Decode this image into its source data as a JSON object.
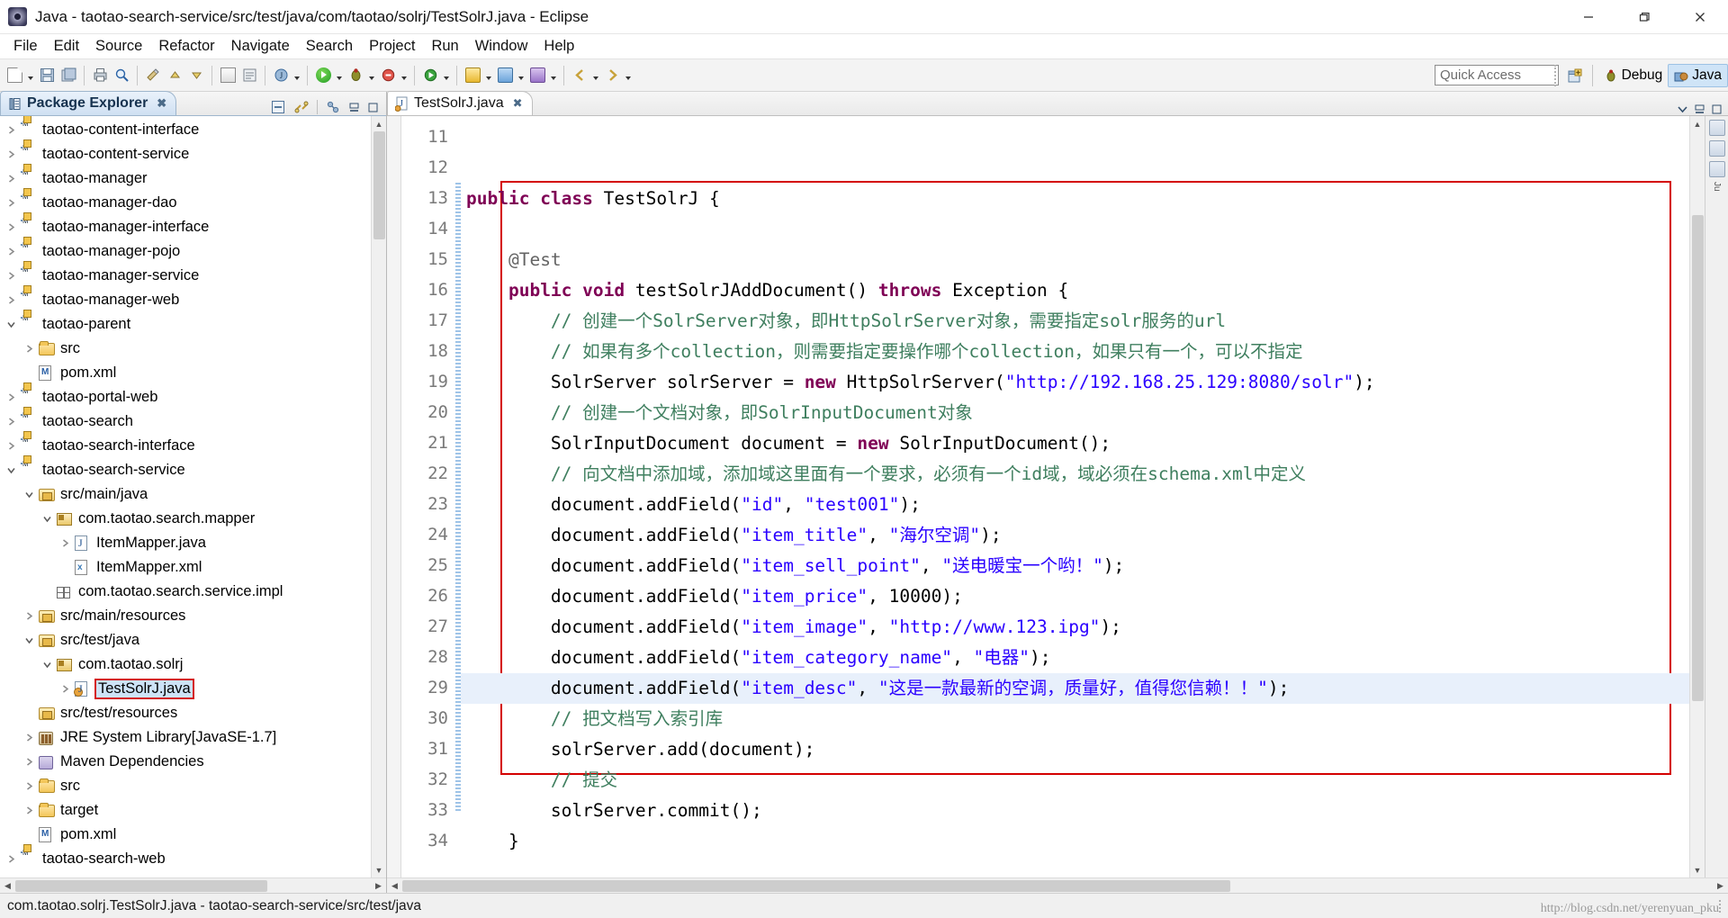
{
  "window": {
    "title": "Java - taotao-search-service/src/test/java/com/taotao/solrj/TestSolrJ.java - Eclipse",
    "minimize_label": "Minimize",
    "restore_label": "Restore",
    "close_label": "Close"
  },
  "menubar": {
    "items": [
      "File",
      "Edit",
      "Source",
      "Refactor",
      "Navigate",
      "Search",
      "Project",
      "Run",
      "Window",
      "Help"
    ]
  },
  "toolbar": {
    "quick_access_placeholder": "Quick Access",
    "perspectives": [
      {
        "label": "Debug",
        "active": false
      },
      {
        "label": "Java",
        "active": true
      }
    ],
    "open_perspective_tooltip": "Open Perspective"
  },
  "package_explorer": {
    "title": "Package Explorer",
    "close_label": "✖",
    "tree": [
      {
        "label": "taotao-content-interface",
        "indent": 0,
        "twisty": "collapsed",
        "icon": "maven-project-icon"
      },
      {
        "label": "taotao-content-service",
        "indent": 0,
        "twisty": "collapsed",
        "icon": "maven-project-icon"
      },
      {
        "label": "taotao-manager",
        "indent": 0,
        "twisty": "collapsed",
        "icon": "maven-project-icon"
      },
      {
        "label": "taotao-manager-dao",
        "indent": 0,
        "twisty": "collapsed",
        "icon": "maven-project-icon"
      },
      {
        "label": "taotao-manager-interface",
        "indent": 0,
        "twisty": "collapsed",
        "icon": "maven-project-icon"
      },
      {
        "label": "taotao-manager-pojo",
        "indent": 0,
        "twisty": "collapsed",
        "icon": "maven-project-icon"
      },
      {
        "label": "taotao-manager-service",
        "indent": 0,
        "twisty": "collapsed",
        "icon": "maven-project-icon"
      },
      {
        "label": "taotao-manager-web",
        "indent": 0,
        "twisty": "collapsed",
        "icon": "maven-project-icon"
      },
      {
        "label": "taotao-parent",
        "indent": 0,
        "twisty": "expanded",
        "icon": "maven-project-icon"
      },
      {
        "label": "src",
        "indent": 1,
        "twisty": "collapsed",
        "icon": "folder-icon"
      },
      {
        "label": "pom.xml",
        "indent": 1,
        "twisty": "none",
        "icon": "xml-file-icon"
      },
      {
        "label": "taotao-portal-web",
        "indent": 0,
        "twisty": "collapsed",
        "icon": "maven-project-icon"
      },
      {
        "label": "taotao-search",
        "indent": 0,
        "twisty": "collapsed",
        "icon": "maven-project-icon"
      },
      {
        "label": "taotao-search-interface",
        "indent": 0,
        "twisty": "collapsed",
        "icon": "maven-project-icon"
      },
      {
        "label": "taotao-search-service",
        "indent": 0,
        "twisty": "expanded",
        "icon": "maven-project-icon"
      },
      {
        "label": "src/main/java",
        "indent": 1,
        "twisty": "expanded",
        "icon": "source-folder-icon"
      },
      {
        "label": "com.taotao.search.mapper",
        "indent": 2,
        "twisty": "expanded",
        "icon": "package-icon"
      },
      {
        "label": "ItemMapper.java",
        "indent": 3,
        "twisty": "collapsed",
        "icon": "java-file-icon"
      },
      {
        "label": "ItemMapper.xml",
        "indent": 3,
        "twisty": "none",
        "icon": "xml-doc-icon"
      },
      {
        "label": "com.taotao.search.service.impl",
        "indent": 2,
        "twisty": "none",
        "icon": "empty-package-icon"
      },
      {
        "label": "src/main/resources",
        "indent": 1,
        "twisty": "collapsed",
        "icon": "source-folder-icon"
      },
      {
        "label": "src/test/java",
        "indent": 1,
        "twisty": "expanded",
        "icon": "source-folder-icon"
      },
      {
        "label": "com.taotao.solrj",
        "indent": 2,
        "twisty": "expanded",
        "icon": "package-icon"
      },
      {
        "label": "TestSolrJ.java",
        "indent": 3,
        "twisty": "collapsed",
        "icon": "java-test-file-icon",
        "selected": true
      },
      {
        "label": "src/test/resources",
        "indent": 1,
        "twisty": "none",
        "icon": "source-folder-icon"
      },
      {
        "label": "JRE System Library",
        "suffix": " [JavaSE-1.7]",
        "indent": 1,
        "twisty": "collapsed",
        "icon": "jre-library-icon"
      },
      {
        "label": "Maven Dependencies",
        "indent": 1,
        "twisty": "collapsed",
        "icon": "maven-dependencies-icon"
      },
      {
        "label": "src",
        "indent": 1,
        "twisty": "collapsed",
        "icon": "folder-icon"
      },
      {
        "label": "target",
        "indent": 1,
        "twisty": "collapsed",
        "icon": "folder-icon"
      },
      {
        "label": "pom.xml",
        "indent": 1,
        "twisty": "none",
        "icon": "xml-file-icon"
      },
      {
        "label": "taotao-search-web",
        "indent": 0,
        "twisty": "collapsed",
        "icon": "maven-project-icon"
      }
    ]
  },
  "editor": {
    "tab_label": "TestSolrJ.java",
    "tab_close": "✖",
    "first_line_number": 11,
    "highlighted_line": 27,
    "folded_line": 13,
    "lines": [
      {
        "n": 11,
        "tokens": [
          {
            "t": "public ",
            "c": "k"
          },
          {
            "t": "class ",
            "c": "k"
          },
          {
            "t": "TestSolrJ {",
            "c": "pl"
          }
        ]
      },
      {
        "n": 12,
        "tokens": []
      },
      {
        "n": 13,
        "tokens": [
          {
            "t": "    ",
            "c": "pl"
          },
          {
            "t": "@Test",
            "c": "an"
          }
        ]
      },
      {
        "n": 14,
        "tokens": [
          {
            "t": "    ",
            "c": "pl"
          },
          {
            "t": "public ",
            "c": "k"
          },
          {
            "t": "void ",
            "c": "k"
          },
          {
            "t": "testSolrJAddDocument() ",
            "c": "pl"
          },
          {
            "t": "throws ",
            "c": "k"
          },
          {
            "t": "Exception {",
            "c": "pl"
          }
        ]
      },
      {
        "n": 15,
        "tokens": [
          {
            "t": "        // 创建一个SolrServer对象，即HttpSolrServer对象，需要指定solr服务的url",
            "c": "cm"
          }
        ]
      },
      {
        "n": 16,
        "tokens": [
          {
            "t": "        // 如果有多个collection，则需要指定要操作哪个collection，如果只有一个，可以不指定",
            "c": "cm"
          }
        ]
      },
      {
        "n": 17,
        "tokens": [
          {
            "t": "        SolrServer solrServer = ",
            "c": "pl"
          },
          {
            "t": "new ",
            "c": "k"
          },
          {
            "t": "HttpSolrServer(",
            "c": "pl"
          },
          {
            "t": "\"http://192.168.25.129:8080/solr\"",
            "c": "st"
          },
          {
            "t": ");",
            "c": "pl"
          }
        ]
      },
      {
        "n": 18,
        "tokens": [
          {
            "t": "        // 创建一个文档对象，即SolrInputDocument对象",
            "c": "cm"
          }
        ]
      },
      {
        "n": 19,
        "tokens": [
          {
            "t": "        SolrInputDocument document = ",
            "c": "pl"
          },
          {
            "t": "new ",
            "c": "k"
          },
          {
            "t": "SolrInputDocument();",
            "c": "pl"
          }
        ]
      },
      {
        "n": 20,
        "tokens": [
          {
            "t": "        // 向文档中添加域，添加域这里面有一个要求，必须有一个id域，域必须在schema.xml中定义",
            "c": "cm"
          }
        ]
      },
      {
        "n": 21,
        "tokens": [
          {
            "t": "        document.addField(",
            "c": "pl"
          },
          {
            "t": "\"id\"",
            "c": "st"
          },
          {
            "t": ", ",
            "c": "pl"
          },
          {
            "t": "\"test001\"",
            "c": "st"
          },
          {
            "t": ");",
            "c": "pl"
          }
        ]
      },
      {
        "n": 22,
        "tokens": [
          {
            "t": "        document.addField(",
            "c": "pl"
          },
          {
            "t": "\"item_title\"",
            "c": "st"
          },
          {
            "t": ", ",
            "c": "pl"
          },
          {
            "t": "\"海尔空调\"",
            "c": "st"
          },
          {
            "t": ");",
            "c": "pl"
          }
        ]
      },
      {
        "n": 23,
        "tokens": [
          {
            "t": "        document.addField(",
            "c": "pl"
          },
          {
            "t": "\"item_sell_point\"",
            "c": "st"
          },
          {
            "t": ", ",
            "c": "pl"
          },
          {
            "t": "\"送电暖宝一个哟！\"",
            "c": "st"
          },
          {
            "t": ");",
            "c": "pl"
          }
        ]
      },
      {
        "n": 24,
        "tokens": [
          {
            "t": "        document.addField(",
            "c": "pl"
          },
          {
            "t": "\"item_price\"",
            "c": "st"
          },
          {
            "t": ", ",
            "c": "pl"
          },
          {
            "t": "10000",
            "c": "num"
          },
          {
            "t": ");",
            "c": "pl"
          }
        ]
      },
      {
        "n": 25,
        "tokens": [
          {
            "t": "        document.addField(",
            "c": "pl"
          },
          {
            "t": "\"item_image\"",
            "c": "st"
          },
          {
            "t": ", ",
            "c": "pl"
          },
          {
            "t": "\"http://www.123.ipg\"",
            "c": "st"
          },
          {
            "t": ");",
            "c": "pl"
          }
        ]
      },
      {
        "n": 26,
        "tokens": [
          {
            "t": "        document.addField(",
            "c": "pl"
          },
          {
            "t": "\"item_category_name\"",
            "c": "st"
          },
          {
            "t": ", ",
            "c": "pl"
          },
          {
            "t": "\"电器\"",
            "c": "st"
          },
          {
            "t": ");",
            "c": "pl"
          }
        ]
      },
      {
        "n": 27,
        "tokens": [
          {
            "t": "        document.addField(",
            "c": "pl"
          },
          {
            "t": "\"item_desc\"",
            "c": "st"
          },
          {
            "t": ", ",
            "c": "pl"
          },
          {
            "t": "\"这是一款最新的空调，质量好，值得您信赖！！\"",
            "c": "st"
          },
          {
            "t": ");",
            "c": "pl"
          }
        ]
      },
      {
        "n": 28,
        "tokens": [
          {
            "t": "        // 把文档写入索引库",
            "c": "cm"
          }
        ]
      },
      {
        "n": 29,
        "tokens": [
          {
            "t": "        solrServer.add(document);",
            "c": "pl"
          }
        ]
      },
      {
        "n": 30,
        "tokens": [
          {
            "t": "        // 提交",
            "c": "cm"
          }
        ]
      },
      {
        "n": 31,
        "tokens": [
          {
            "t": "        solrServer.commit();",
            "c": "pl"
          }
        ]
      },
      {
        "n": 32,
        "tokens": [
          {
            "t": "    }",
            "c": "pl"
          }
        ]
      },
      {
        "n": 33,
        "tokens": []
      },
      {
        "n": 34,
        "tokens": [
          {
            "t": "}",
            "c": "pl"
          }
        ]
      }
    ]
  },
  "statusbar": {
    "text": "com.taotao.solrj.TestSolrJ.java - taotao-search-service/src/test/java",
    "watermark": "http://blog.csdn.net/yerenyuan_pku"
  },
  "colors": {
    "keyword": "#7f0055",
    "comment": "#3f7f5f",
    "string": "#2a00ff",
    "annotation": "#646464",
    "selection": "#cde3f7",
    "highlight_border": "#d40000",
    "current_line": "#e8f0fb"
  }
}
